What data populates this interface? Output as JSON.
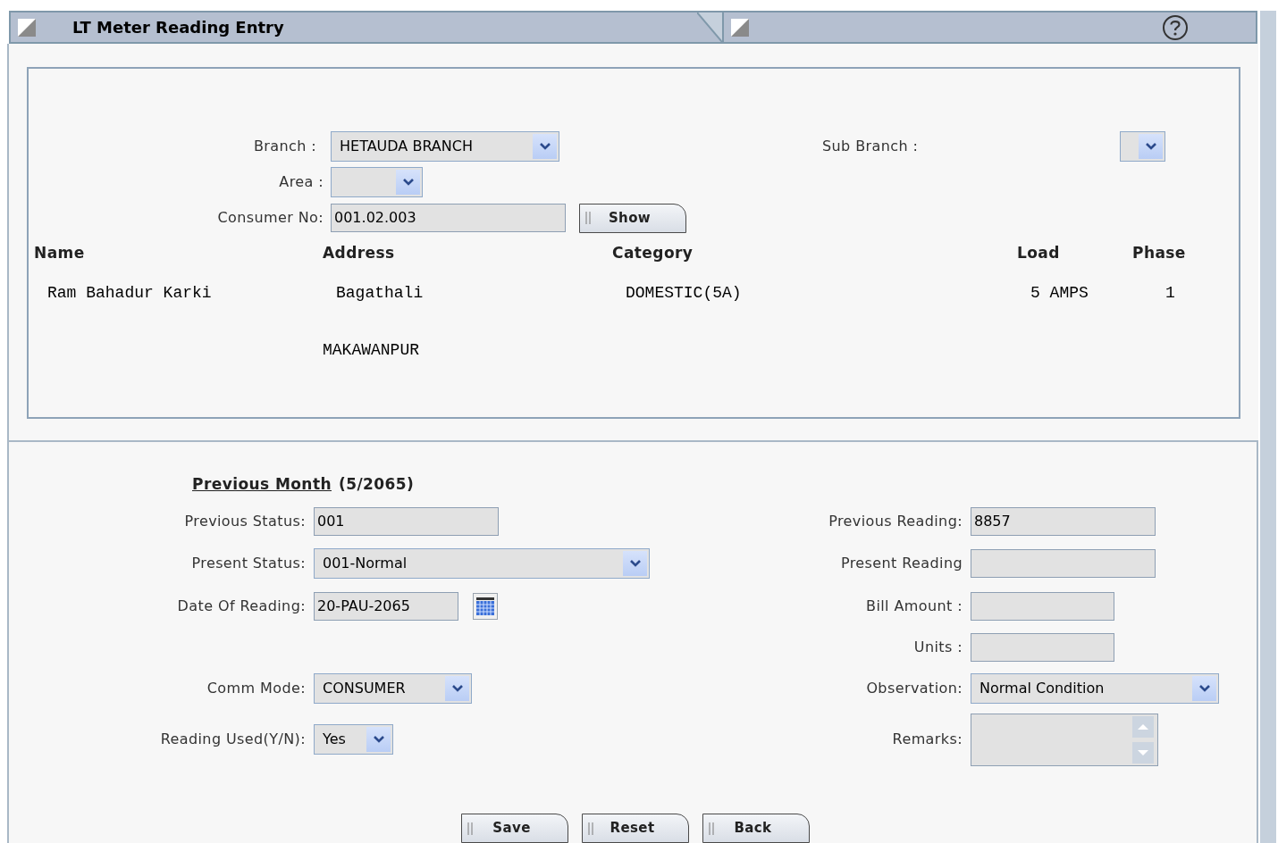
{
  "window": {
    "title": "LT Meter Reading Entry"
  },
  "top_form": {
    "branch": {
      "label": "Branch :",
      "value": "HETAUDA BRANCH"
    },
    "sub_branch": {
      "label": "Sub Branch :"
    },
    "area": {
      "label": "Area :"
    },
    "consumer_no": {
      "label": "Consumer No:",
      "value": "001.02.003"
    },
    "show_button": "Show"
  },
  "consumer": {
    "columns": [
      "Name",
      "Address",
      "Category",
      "Load",
      "Phase"
    ],
    "values": [
      "Ram Bahadur Karki",
      "Bagathali",
      "DOMESTIC(5A)",
      "5 AMPS",
      "1"
    ],
    "address_line_2": "MAKAWANPUR"
  },
  "reading": {
    "heading": "Previous Month",
    "period": "(5/2065)",
    "left_fields": [
      {
        "label": "Previous Status:",
        "kind": "text",
        "value": "001"
      },
      {
        "label": "Present Status:",
        "kind": "select",
        "value": "001-Normal"
      },
      {
        "label": "Date Of Reading:",
        "kind": "date",
        "value": "20-PAU-2065"
      },
      {
        "label": "Comm Mode:",
        "kind": "select",
        "value": "CONSUMER"
      },
      {
        "label": "Reading Used(Y/N):",
        "kind": "select",
        "value": "Yes"
      }
    ],
    "right_fields": [
      {
        "label": "Previous Reading:",
        "kind": "text",
        "value": "8857"
      },
      {
        "label": "Present Reading",
        "kind": "text"
      },
      {
        "label": "Bill Amount :",
        "kind": "text"
      },
      {
        "label": "Units :",
        "kind": "text"
      },
      {
        "label": "Observation:",
        "kind": "select",
        "value": "Normal Condition"
      },
      {
        "label": "Remarks:",
        "kind": "textarea"
      }
    ]
  },
  "buttons": [
    "Save",
    "Reset",
    "Back"
  ]
}
